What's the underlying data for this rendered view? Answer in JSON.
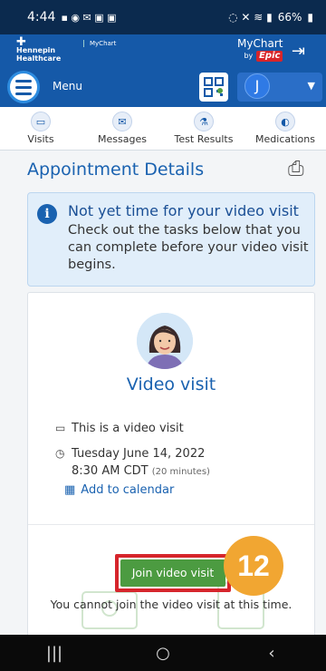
{
  "status_bar": {
    "time": "4:44",
    "battery": "66%"
  },
  "brand": {
    "org_name_line1": "Hennepin",
    "org_name_line2": "Healthcare",
    "mychart_small": "MyChart",
    "mychart_logo": "MyChart",
    "epic_label": "Epic",
    "by_label": "by"
  },
  "nav": {
    "menu_label": "Menu",
    "user_initial": "J"
  },
  "tabs": [
    {
      "label": "Visits",
      "icon": "calendar-icon"
    },
    {
      "label": "Messages",
      "icon": "envelope-icon"
    },
    {
      "label": "Test Results",
      "icon": "flask-icon"
    },
    {
      "label": "Medications",
      "icon": "pill-icon"
    }
  ],
  "page": {
    "title": "Appointment Details"
  },
  "banner": {
    "title": "Not yet time for your video visit",
    "text": "Check out the tasks below that you can complete before your video visit begins."
  },
  "visit": {
    "title": "Video visit",
    "type_text": "This is a video visit",
    "date": "Tuesday June 14, 2022",
    "time": "8:30 AM CDT",
    "duration": "(20 minutes)",
    "add_calendar": "Add to calendar",
    "join_button": "Join video visit",
    "cannot_join": "You cannot join the video visit at this time."
  },
  "annotation": {
    "step_number": "12"
  },
  "colors": {
    "brand_blue": "#1559a8",
    "link_blue": "#1a62b0",
    "join_green": "#4c9b41",
    "highlight_red": "#d6252c",
    "badge_orange": "#f1a632"
  }
}
